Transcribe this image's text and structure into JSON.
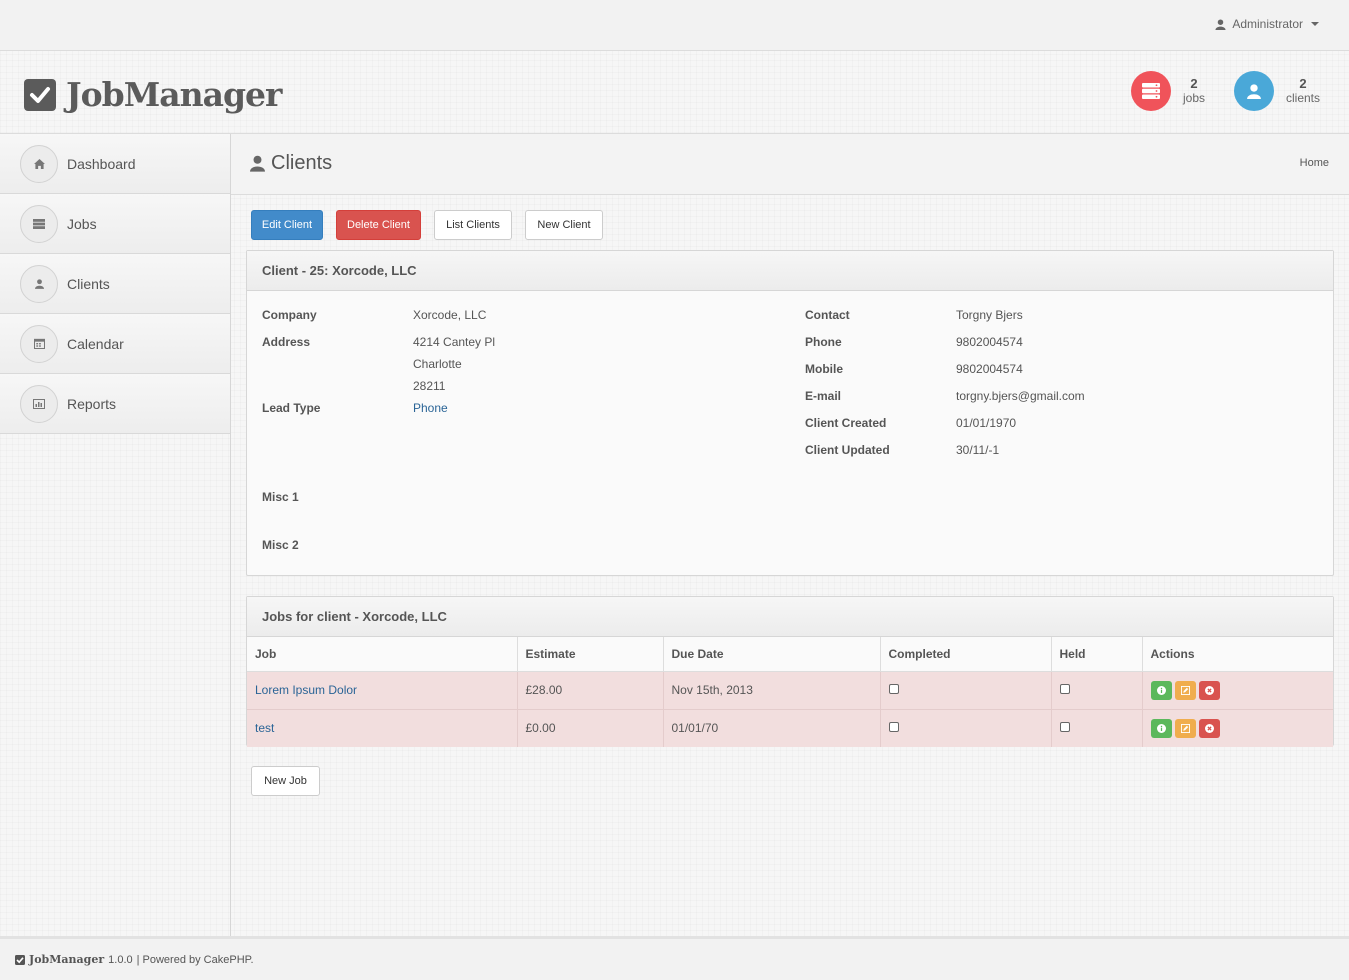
{
  "topbar": {
    "user_label": "Administrator"
  },
  "header": {
    "logo_text": "JobManager",
    "stats": [
      {
        "count": "2",
        "label": "jobs",
        "color": "#f0535a",
        "icon": "server-icon"
      },
      {
        "count": "2",
        "label": "clients",
        "color": "#4aa8d8",
        "icon": "user-icon"
      }
    ]
  },
  "sidebar": {
    "items": [
      {
        "label": "Dashboard",
        "icon": "home-icon"
      },
      {
        "label": "Jobs",
        "icon": "server-icon"
      },
      {
        "label": "Clients",
        "icon": "user-icon"
      },
      {
        "label": "Calendar",
        "icon": "calendar-icon"
      },
      {
        "label": "Reports",
        "icon": "bar-chart-icon"
      }
    ]
  },
  "page": {
    "title": "Clients",
    "breadcrumb": "Home"
  },
  "toolbar": {
    "edit_label": "Edit Client",
    "delete_label": "Delete Client",
    "list_label": "List Clients",
    "new_label": "New Client"
  },
  "client": {
    "panel_title": "Client - 25: Xorcode, LLC",
    "left": {
      "company_label": "Company",
      "company": "Xorcode, LLC",
      "address_label": "Address",
      "address_line1": "4214 Cantey Pl",
      "address_line2": "Charlotte",
      "address_line3": "28211",
      "lead_type_label": "Lead Type",
      "lead_type": "Phone",
      "misc1_label": "Misc 1",
      "misc2_label": "Misc 2"
    },
    "right": {
      "contact_label": "Contact",
      "contact": "Torgny Bjers",
      "phone_label": "Phone",
      "phone": "9802004574",
      "mobile_label": "Mobile",
      "mobile": "9802004574",
      "email_label": "E-mail",
      "email": "torgny.bjers@gmail.com",
      "created_label": "Client Created",
      "created": "01/01/1970",
      "updated_label": "Client Updated",
      "updated": "30/11/-1"
    }
  },
  "jobs": {
    "panel_title": "Jobs for client - Xorcode, LLC",
    "columns": [
      "Job",
      "Estimate",
      "Due Date",
      "Completed",
      "Held",
      "Actions"
    ],
    "rows": [
      {
        "job": "Lorem Ipsum Dolor",
        "estimate": "£28.00",
        "due": "Nov 15th, 2013",
        "completed": false,
        "held": false
      },
      {
        "job": "test",
        "estimate": "£0.00",
        "due": "01/01/70",
        "completed": false,
        "held": false
      }
    ],
    "new_job_label": "New Job"
  },
  "footer": {
    "logo_text": "JobManager",
    "version": "1.0.0",
    "powered_by": "| Powered by CakePHP."
  }
}
